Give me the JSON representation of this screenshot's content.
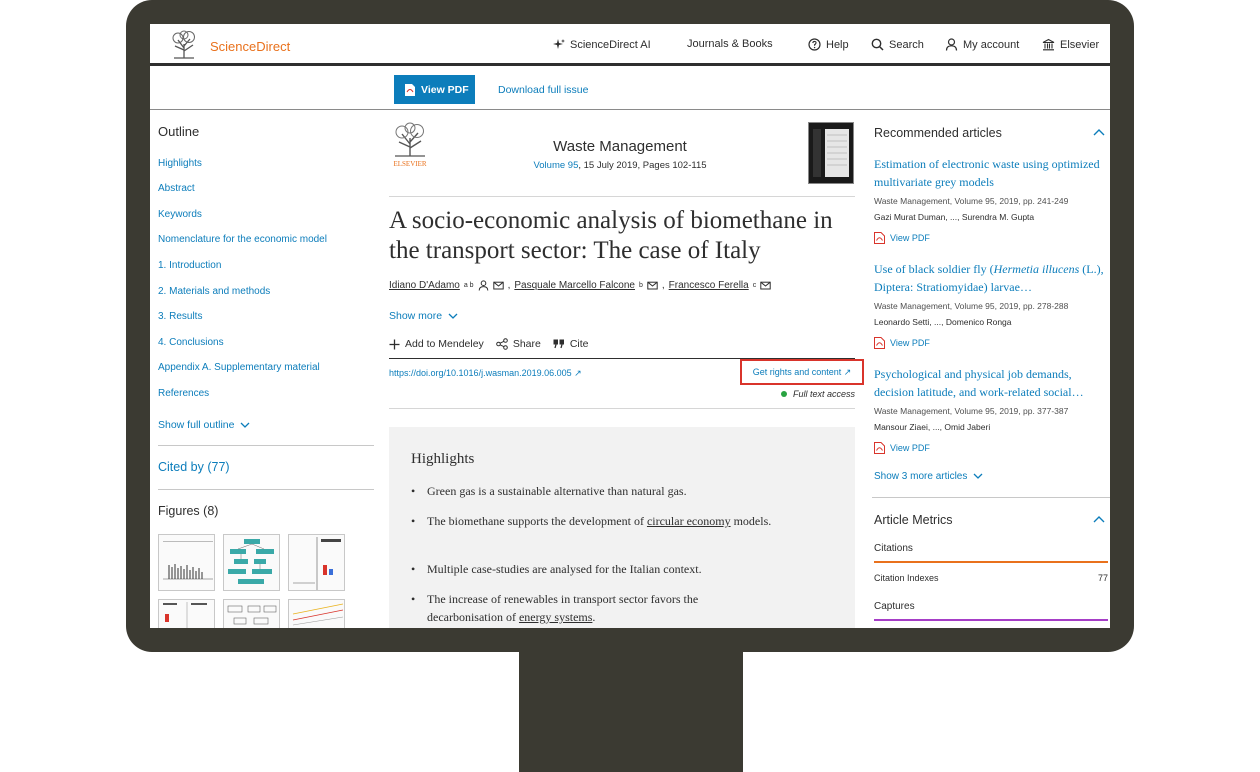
{
  "header": {
    "brand": "ScienceDirect",
    "nav": [
      {
        "label": "ScienceDirect AI",
        "icon": "sparkle-icon"
      },
      {
        "label": "Journals & Books",
        "icon": ""
      },
      {
        "label": "Help",
        "icon": "help-icon"
      },
      {
        "label": "Search",
        "icon": "search-icon"
      },
      {
        "label": "My account",
        "icon": "user-icon"
      },
      {
        "label": "Elsevier",
        "icon": "institution-icon"
      }
    ]
  },
  "pdfbar": {
    "view_pdf": "View PDF",
    "download_issue": "Download full issue"
  },
  "outline": {
    "title": "Outline",
    "items": [
      "Highlights",
      "Abstract",
      "Keywords",
      "Nomenclature for the economic model",
      "1. Introduction",
      "2. Materials and methods",
      "3. Results",
      "4. Conclusions",
      "Appendix A. Supplementary material",
      "References"
    ],
    "show_full": "Show full outline",
    "cited_by": "Cited by (77)",
    "figures": "Figures (8)"
  },
  "article": {
    "journal": "Waste Management",
    "volume_link": "Volume 95",
    "volume_rest": ", 15 July 2019, Pages 102-115",
    "title": "A socio-economic analysis of biomethane in the transport sector: The case of Italy",
    "authors": [
      {
        "name": "Idiano D'Adamo",
        "sup": "a b"
      },
      {
        "name": "Pasquale Marcello Falcone",
        "sup": "b"
      },
      {
        "name": "Francesco Ferella",
        "sup": "c"
      }
    ],
    "show_more": "Show more",
    "actions": {
      "mendeley": "Add to Mendeley",
      "share": "Share",
      "cite": "Cite"
    },
    "doi": "https://doi.org/10.1016/j.wasman.2019.06.005",
    "rights": "Get rights and content",
    "access": "Full text access",
    "highlights_title": "Highlights",
    "highlights": [
      {
        "before": "Green gas is a sustainable alternative than natural gas.",
        "link": "",
        "after": ""
      },
      {
        "before": "The biomethane supports the development of ",
        "link": "circular economy",
        "after": " models."
      },
      {
        "before": "Multiple case-studies are analysed for the Italian context.",
        "link": "",
        "after": ""
      },
      {
        "before": "The increase of renewables in transport sector favors the decarbonisation of ",
        "link": "energy systems",
        "after": "."
      }
    ]
  },
  "sidebar": {
    "recommended_title": "Recommended articles",
    "recommended": [
      {
        "title": "Estimation of electronic waste using optimized multivariate grey models",
        "meta": "Waste Management, Volume 95, 2019, pp. 241-249",
        "authors": "Gazi Murat Duman, ..., Surendra M. Gupta",
        "pdf": "View PDF"
      },
      {
        "title_a": "Use of black soldier fly (",
        "title_i": "Hermetia illucens",
        "title_b": " (L.), Diptera: Stratiomyidae) larvae…",
        "meta": "Waste Management, Volume 95, 2019, pp. 278-288",
        "authors": "Leonardo Setti, ..., Domenico Ronga",
        "pdf": "View PDF"
      },
      {
        "title": "Psychological and physical job demands, decision latitude, and work-related social…",
        "meta": "Waste Management, Volume 95, 2019, pp. 377-387",
        "authors": "Mansour Ziaei, ..., Omid Jaberi",
        "pdf": "View PDF"
      }
    ],
    "show_more": "Show 3 more articles",
    "metrics_title": "Article Metrics",
    "citations_label": "Citations",
    "citation_indexes_label": "Citation Indexes",
    "citation_indexes_value": "77",
    "captures_label": "Captures",
    "colors": {
      "citations": "#e9711c",
      "captures": "#a63ec7",
      "accent": "#0c7dbb"
    }
  }
}
